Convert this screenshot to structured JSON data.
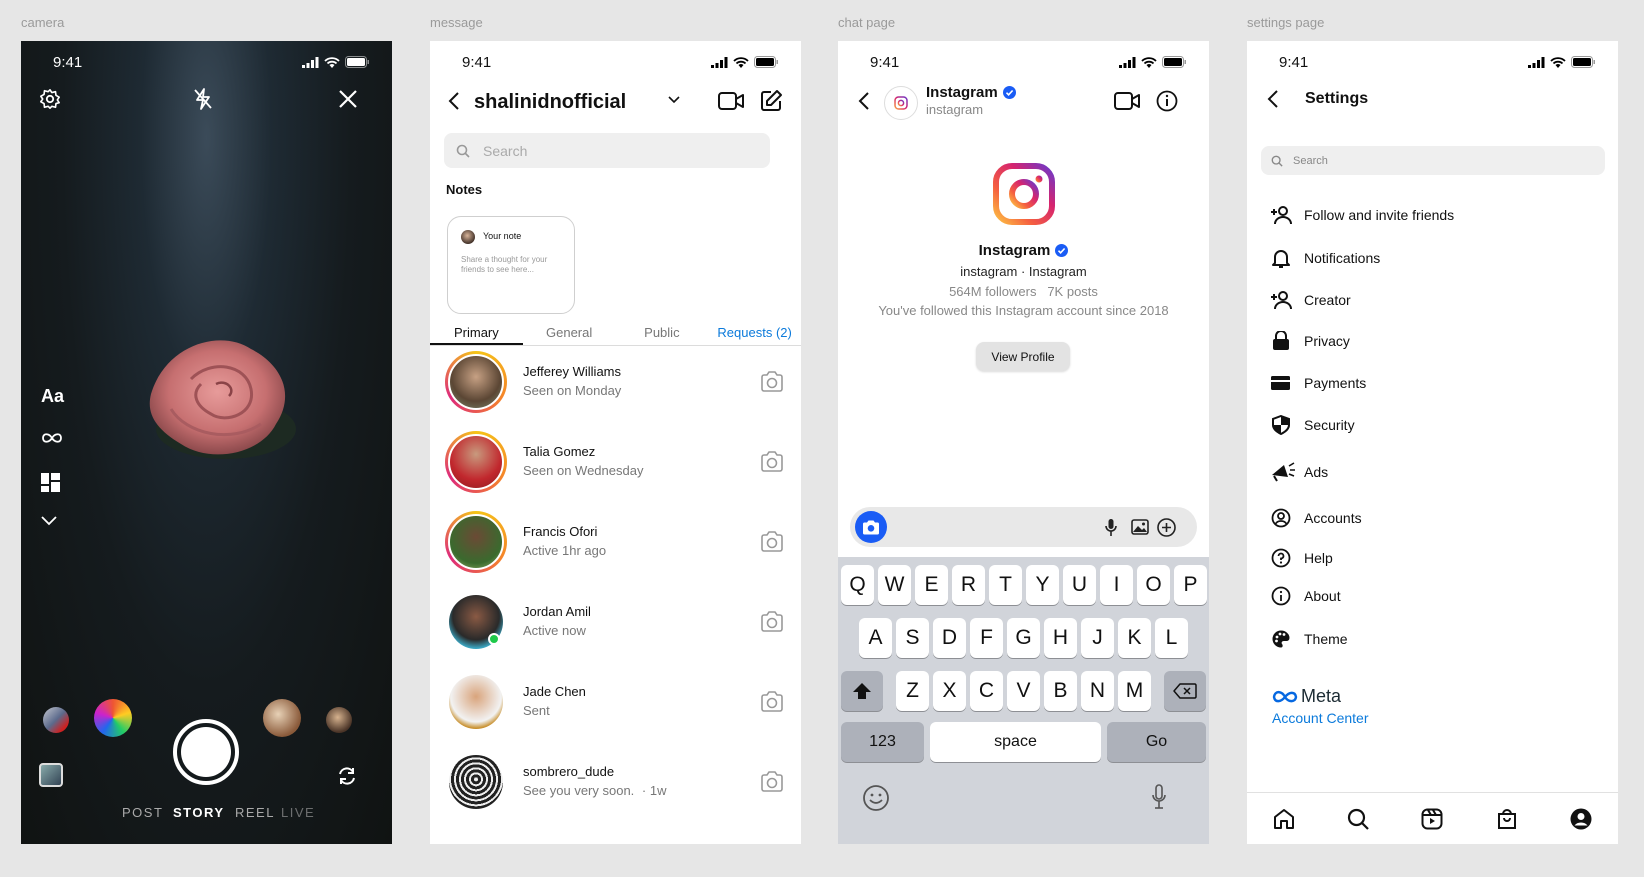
{
  "labels": {
    "camera": "camera",
    "message": "message",
    "chat": "chat page",
    "settings": "settings page"
  },
  "status_time": "9:41",
  "camera": {
    "tools": {
      "text": "Aa"
    },
    "modes": [
      "POST",
      "STORY",
      "REEL",
      "LIVE"
    ],
    "active_mode": "STORY"
  },
  "message": {
    "username": "shalinidnofficial",
    "search_placeholder": "Search",
    "notes_heading": "Notes",
    "note": {
      "title": "Your note",
      "body": "Share a thought for your friends to see here..."
    },
    "tabs": [
      "Primary",
      "General",
      "Public",
      "Requests (2)"
    ],
    "threads": [
      {
        "name": "Jefferey Williams",
        "status": "Seen on Monday"
      },
      {
        "name": "Talia Gomez",
        "status": "Seen on Wednesday"
      },
      {
        "name": "Francis Ofori",
        "status": "Active 1hr ago"
      },
      {
        "name": "Jordan Amil",
        "status": "Active now"
      },
      {
        "name": "Jade Chen",
        "status": "Sent"
      },
      {
        "name": "sombrero_dude",
        "status": "See you very soon.",
        "time": "· 1w"
      }
    ]
  },
  "chat": {
    "name": "Instagram",
    "handle": "instagram",
    "profile_name": "Instagram",
    "profile_sub": "instagram · Instagram",
    "stats": "564M followers   7K posts",
    "since": "You've followed this Instagram account since 2018",
    "view_profile": "View Profile",
    "keyboard": {
      "row1": [
        "Q",
        "W",
        "E",
        "R",
        "T",
        "Y",
        "U",
        "I",
        "O",
        "P"
      ],
      "row2": [
        "A",
        "S",
        "D",
        "F",
        "G",
        "H",
        "J",
        "K",
        "L"
      ],
      "row3": [
        "Z",
        "X",
        "C",
        "V",
        "B",
        "N",
        "M"
      ],
      "num": "123",
      "space": "space",
      "go": "Go"
    }
  },
  "settings": {
    "title": "Settings",
    "search_placeholder": "Search",
    "items": [
      {
        "label": "Follow and invite friends",
        "icon": "add-user-icon"
      },
      {
        "label": "Notifications",
        "icon": "bell-icon"
      },
      {
        "label": "Creator",
        "icon": "add-user-icon"
      },
      {
        "label": "Privacy",
        "icon": "lock-icon"
      },
      {
        "label": "Payments",
        "icon": "card-icon"
      },
      {
        "label": "Security",
        "icon": "shield-icon"
      },
      {
        "label": "Ads",
        "icon": "megaphone-icon"
      },
      {
        "label": "Accounts",
        "icon": "account-circle-icon"
      },
      {
        "label": "Help",
        "icon": "help-icon"
      },
      {
        "label": "About",
        "icon": "info-icon"
      },
      {
        "label": "Theme",
        "icon": "palette-icon"
      }
    ],
    "meta_label": "Meta",
    "account_center": "Account Center"
  }
}
